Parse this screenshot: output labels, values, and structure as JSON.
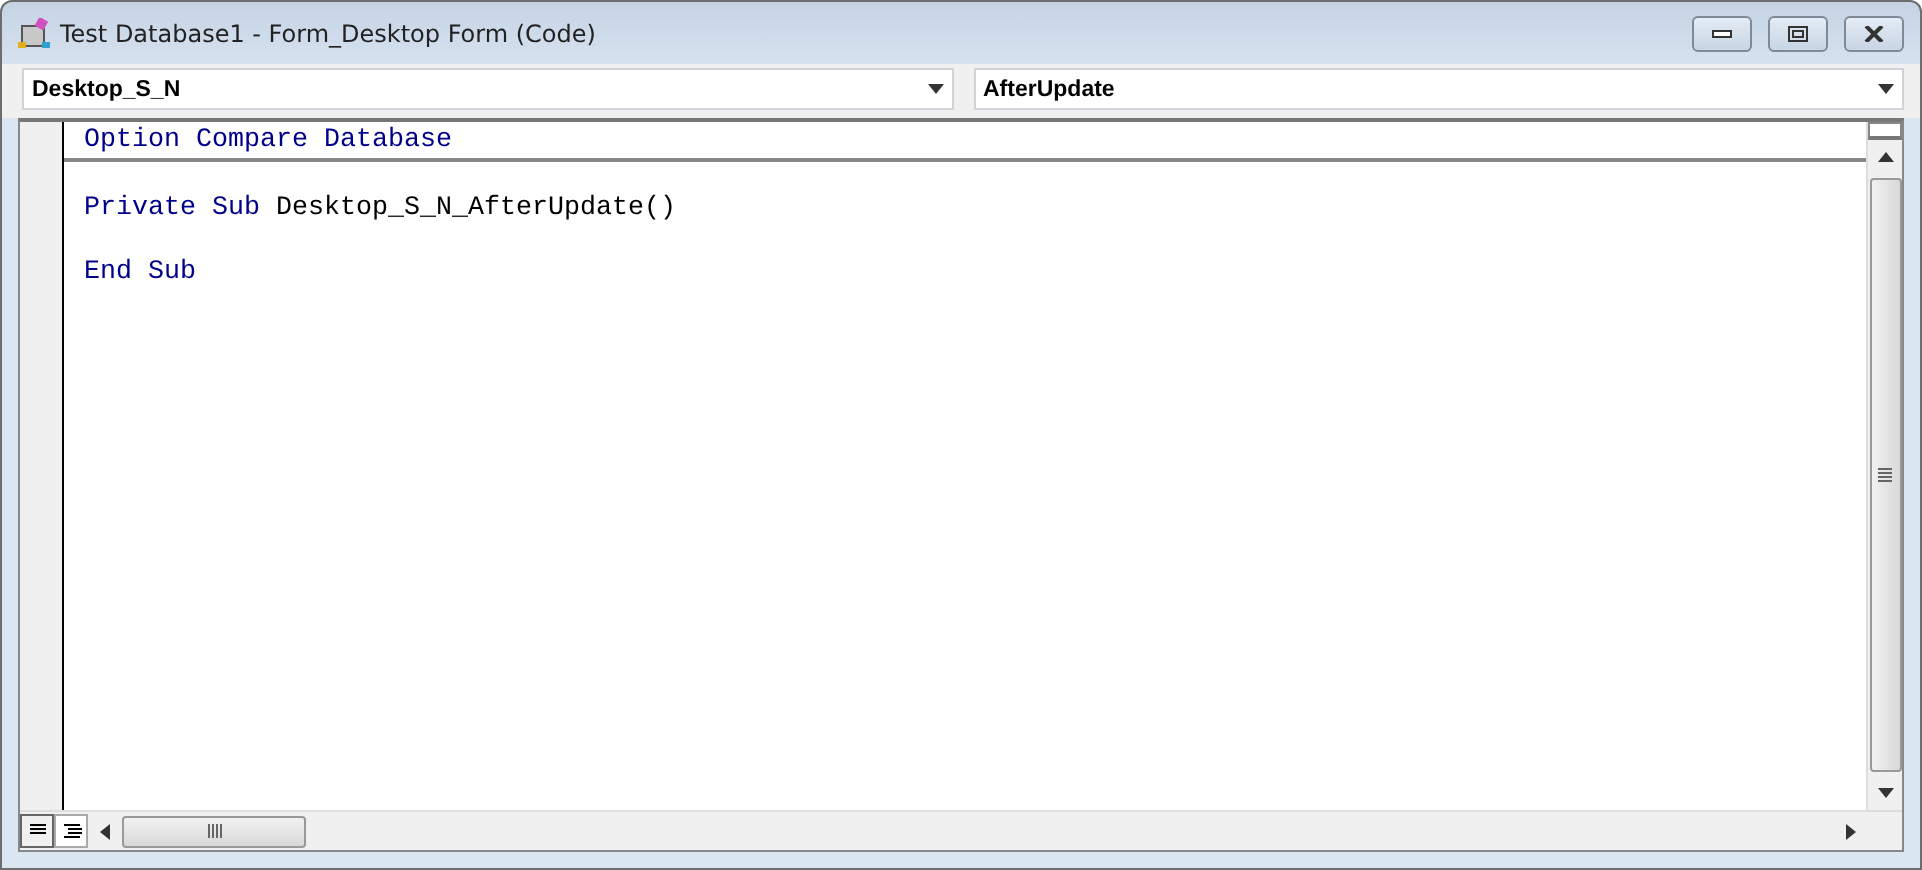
{
  "window": {
    "title": "Test Database1 - Form_Desktop Form (Code)"
  },
  "object_dropdown": {
    "value": "Desktop_S_N"
  },
  "procedure_dropdown": {
    "value": "AfterUpdate"
  },
  "code_sections": [
    {
      "lines": [
        [
          {
            "kind": "keyword",
            "text": "Option Compare Database"
          }
        ]
      ]
    },
    {
      "lines": [
        [
          {
            "kind": "keyword",
            "text": "Private Sub "
          },
          {
            "kind": "plain",
            "text": "Desktop_S_N_AfterUpdate()"
          }
        ],
        [
          {
            "kind": "keyword",
            "text": "End Sub"
          }
        ]
      ]
    }
  ],
  "view_buttons": [
    {
      "kind": "procedure",
      "selected": false
    },
    {
      "kind": "module",
      "selected": true
    }
  ]
}
